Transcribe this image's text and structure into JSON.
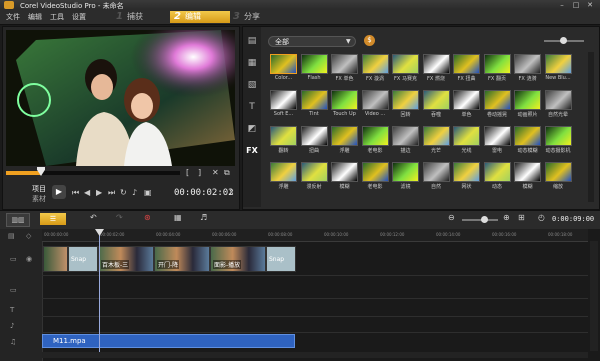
{
  "window": {
    "title": "Corel VideoStudio Pro - 未命名",
    "controls": [
      "–",
      "□",
      "✕"
    ]
  },
  "menu": [
    "文件",
    "编辑",
    "工具",
    "设置"
  ],
  "steps": [
    {
      "num": "1",
      "label": "捕获"
    },
    {
      "num": "2",
      "label": "编辑"
    },
    {
      "num": "3",
      "label": "分享"
    }
  ],
  "preview": {
    "project_label": "项目",
    "clip_label": "素材",
    "timecode": "00:00:02:02",
    "scrub_position": 0.2
  },
  "library": {
    "filter": "全部",
    "items": [
      "Color...",
      "Flash",
      "FX 单色",
      "FX 漩涡",
      "FX 马赛克",
      "FX 燃烧",
      "FX 扭曲",
      "FX 翻页",
      "FX 涟漪",
      "New Blu...",
      "Soft E...",
      "Tint",
      "Touch Up",
      "Video ...",
      "回转",
      "吞噬",
      "单色",
      "卷动摇晃",
      "动画照片",
      "自然光晕",
      "翻转",
      "扭曲",
      "浮雕",
      "老电影",
      "描边",
      "光芒",
      "光线",
      "雷电",
      "动态模糊",
      "动态摄影机",
      "浮雕",
      "漫反射",
      "模糊",
      "老电影",
      "滤镜",
      "自然",
      "网状",
      "动态",
      "模糊",
      "缩放"
    ]
  },
  "timeline": {
    "timecode": "0:00:09:00",
    "ruler": [
      "00:00:00:00",
      "00:00:02:00",
      "00:00:04:00",
      "00:00:06:00",
      "00:00:08:00",
      "00:00:10:00",
      "00:00:12:00",
      "00:00:14:00",
      "00:00:16:00",
      "00:00:18:00"
    ],
    "clips": [
      {
        "label": "Snap",
        "kind": "trans"
      },
      {
        "label": "百木板-三",
        "kind": "title"
      },
      {
        "label": "开门-降",
        "kind": "title"
      },
      {
        "label": "面影-播放",
        "kind": "title"
      },
      {
        "label": "Snap",
        "kind": "trans"
      }
    ],
    "music_clip": "M11.mpa"
  },
  "colors": {
    "accent": "#e8a620",
    "music": "#2f63c0",
    "timecode": "#f0f0f0"
  }
}
